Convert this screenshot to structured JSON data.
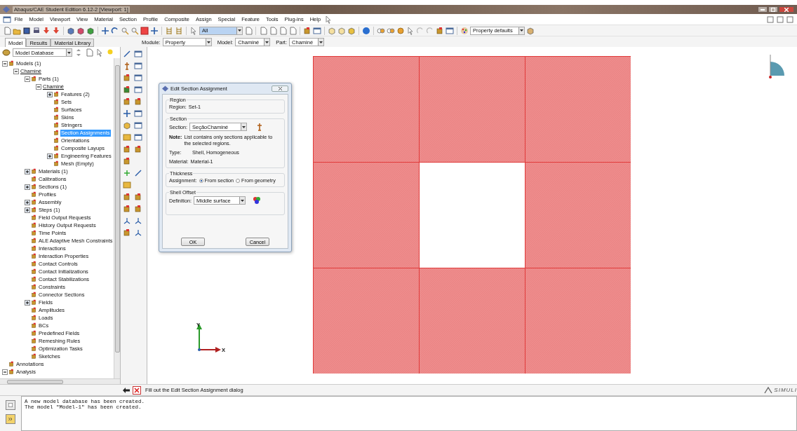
{
  "window": {
    "title": "Abaqus/CAE Student Edition 6.12-2 [Viewport: 1]"
  },
  "menu": [
    "File",
    "Model",
    "Viewport",
    "View",
    "Material",
    "Section",
    "Profile",
    "Composite",
    "Assign",
    "Special",
    "Feature",
    "Tools",
    "Plug-ins",
    "Help"
  ],
  "toolbar": {
    "selection_filter": "All",
    "display_defaults": "Property defaults"
  },
  "panel_tabs": [
    {
      "label": "Model",
      "selected": true
    },
    {
      "label": "Results",
      "selected": false
    },
    {
      "label": "Material Library",
      "selected": false
    }
  ],
  "context": {
    "module_label": "Module:",
    "module": "Property",
    "model_label": "Model:",
    "model": "Chaminé",
    "part_label": "Part:",
    "part": "Chaminé"
  },
  "tree": {
    "database": "Model Database",
    "items": [
      {
        "label": "Models (1)",
        "kind": "folder",
        "expanded": true,
        "selected": false,
        "children": [
          {
            "label": "Chaminé",
            "kind": "instance",
            "expanded": true,
            "selected": false,
            "children": [
              {
                "label": "Parts (1)",
                "kind": "folder",
                "expanded": true,
                "selected": false,
                "children": [
                  {
                    "label": "Chaminé",
                    "kind": "instance",
                    "expanded": true,
                    "selected": false,
                    "children": [
                      {
                        "label": "Features (2)",
                        "kind": "folder",
                        "expanded": false,
                        "selected": false
                      },
                      {
                        "label": "Sets",
                        "kind": "folder",
                        "selected": false
                      },
                      {
                        "label": "Surfaces",
                        "kind": "folder",
                        "selected": false
                      },
                      {
                        "label": "Skins",
                        "kind": "folder",
                        "selected": false
                      },
                      {
                        "label": "Stringers",
                        "kind": "folder",
                        "selected": false
                      },
                      {
                        "label": "Section Assignments",
                        "kind": "folder",
                        "selected": true
                      },
                      {
                        "label": "Orientations",
                        "kind": "folder",
                        "selected": false
                      },
                      {
                        "label": "Composite Layups",
                        "kind": "folder",
                        "selected": false
                      },
                      {
                        "label": "Engineering Features",
                        "kind": "folder",
                        "expanded": false,
                        "selected": false
                      },
                      {
                        "label": "Mesh (Empty)",
                        "kind": "folder",
                        "selected": false
                      }
                    ]
                  }
                ]
              },
              {
                "label": "Materials (1)",
                "kind": "folder",
                "expanded": false,
                "selected": false
              },
              {
                "label": "Calibrations",
                "kind": "folder",
                "selected": false
              },
              {
                "label": "Sections (1)",
                "kind": "folder",
                "expanded": false,
                "selected": false
              },
              {
                "label": "Profiles",
                "kind": "folder",
                "selected": false
              },
              {
                "label": "Assembly",
                "kind": "folder",
                "expanded": false,
                "selected": false
              },
              {
                "label": "Steps (1)",
                "kind": "folder",
                "expanded": false,
                "selected": false
              },
              {
                "label": "Field Output Requests",
                "kind": "folder",
                "selected": false
              },
              {
                "label": "History Output Requests",
                "kind": "folder",
                "selected": false
              },
              {
                "label": "Time Points",
                "kind": "folder",
                "selected": false
              },
              {
                "label": "ALE Adaptive Mesh Constraints",
                "kind": "folder",
                "selected": false
              },
              {
                "label": "Interactions",
                "kind": "folder",
                "selected": false
              },
              {
                "label": "Interaction Properties",
                "kind": "folder",
                "selected": false
              },
              {
                "label": "Contact Controls",
                "kind": "folder",
                "selected": false
              },
              {
                "label": "Contact Initializations",
                "kind": "folder",
                "selected": false
              },
              {
                "label": "Contact Stabilizations",
                "kind": "folder",
                "selected": false
              },
              {
                "label": "Constraints",
                "kind": "folder",
                "selected": false
              },
              {
                "label": "Connector Sections",
                "kind": "folder",
                "selected": false
              },
              {
                "label": "Fields",
                "kind": "folder",
                "expanded": false,
                "selected": false
              },
              {
                "label": "Amplitudes",
                "kind": "folder",
                "selected": false
              },
              {
                "label": "Loads",
                "kind": "folder",
                "selected": false
              },
              {
                "label": "BCs",
                "kind": "folder",
                "selected": false
              },
              {
                "label": "Predefined Fields",
                "kind": "folder",
                "selected": false
              },
              {
                "label": "Remeshing Rules",
                "kind": "folder",
                "selected": false
              },
              {
                "label": "Optimization Tasks",
                "kind": "folder",
                "selected": false
              },
              {
                "label": "Sketches",
                "kind": "folder",
                "selected": false
              }
            ]
          }
        ]
      },
      {
        "label": "Annotations",
        "kind": "folder",
        "selected": false
      },
      {
        "label": "Analysis",
        "kind": "folder",
        "expanded": true,
        "selected": false
      }
    ]
  },
  "dialog": {
    "title": "Edit Section Assignment",
    "region": {
      "heading": "Region",
      "label": "Region:",
      "value": "Set-1"
    },
    "section": {
      "heading": "Section",
      "label": "Section:",
      "value": "SeçãoChaminé",
      "note_label": "Note:",
      "note": "List contains only sections applicable to the selected regions.",
      "type_label": "Type:",
      "type": "Shell, Homogeneous",
      "material_label": "Material:",
      "material": "Material-1"
    },
    "thickness": {
      "heading": "Thickness",
      "label": "Assignment:",
      "options": [
        {
          "label": "From section",
          "selected": true
        },
        {
          "label": "From geometry",
          "selected": false
        }
      ]
    },
    "shell_offset": {
      "heading": "Shell Offset",
      "label": "Definition:",
      "value": "Middle surface"
    },
    "buttons": [
      "OK",
      "Cancel"
    ]
  },
  "viewport": {
    "axis_y": "Y",
    "axis_x": "X"
  },
  "prompt": {
    "text": "Fill out the Edit Section Assignment dialog",
    "brand": "SIMULI"
  },
  "messages": [
    "A new model database has been created.",
    "The model \"Model-1\" has been created."
  ]
}
